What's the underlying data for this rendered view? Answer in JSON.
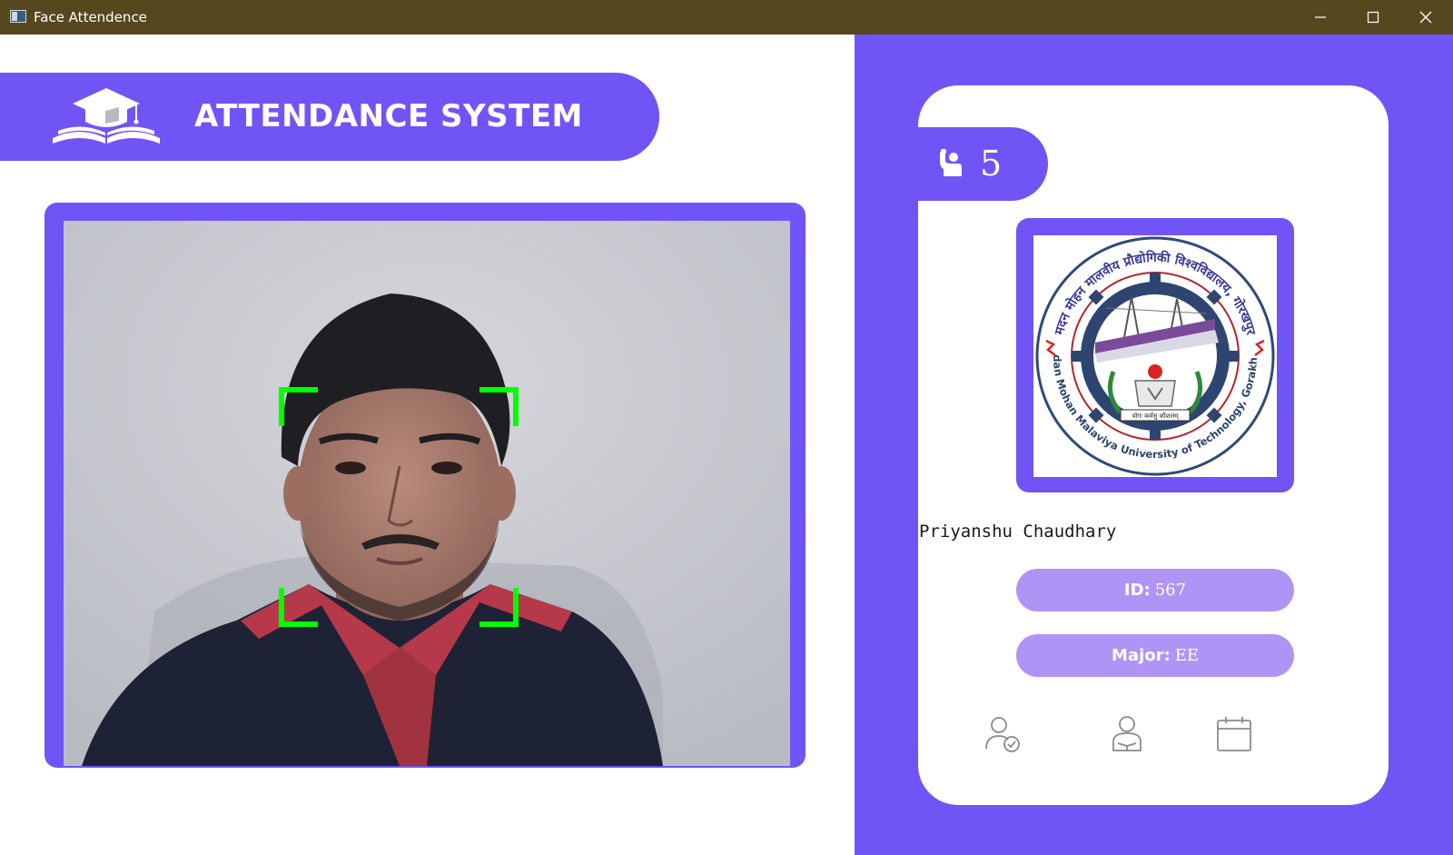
{
  "window": {
    "title": "Face Attendence"
  },
  "header": {
    "title": "ATTENDANCE SYSTEM",
    "logo_icon": "graduation-cap-books-icon"
  },
  "camera": {
    "face_box_color": "#00ff00"
  },
  "student": {
    "count_icon": "raised-hand-person-icon",
    "count": "5",
    "name": "Priyanshu Chaudhary",
    "id_label": "ID:",
    "id_value": "567",
    "major_label": "Major:",
    "major_value": "EE",
    "logo": {
      "hindi_text": "मदन मोहन मालवीय प्रौद्योगिकी विश्वविद्यालय, गोरखपुर",
      "english_text": "Madan Mohan Malaviya University of Technology, Gorakhpur",
      "motto": "योगः कर्मसु कौशलम्"
    }
  },
  "nav": {
    "icons": [
      "user-check-icon",
      "student-reading-icon",
      "calendar-icon"
    ]
  },
  "colors": {
    "accent": "#7154f6",
    "pill": "#b094f5",
    "titlebar": "#55481e"
  }
}
